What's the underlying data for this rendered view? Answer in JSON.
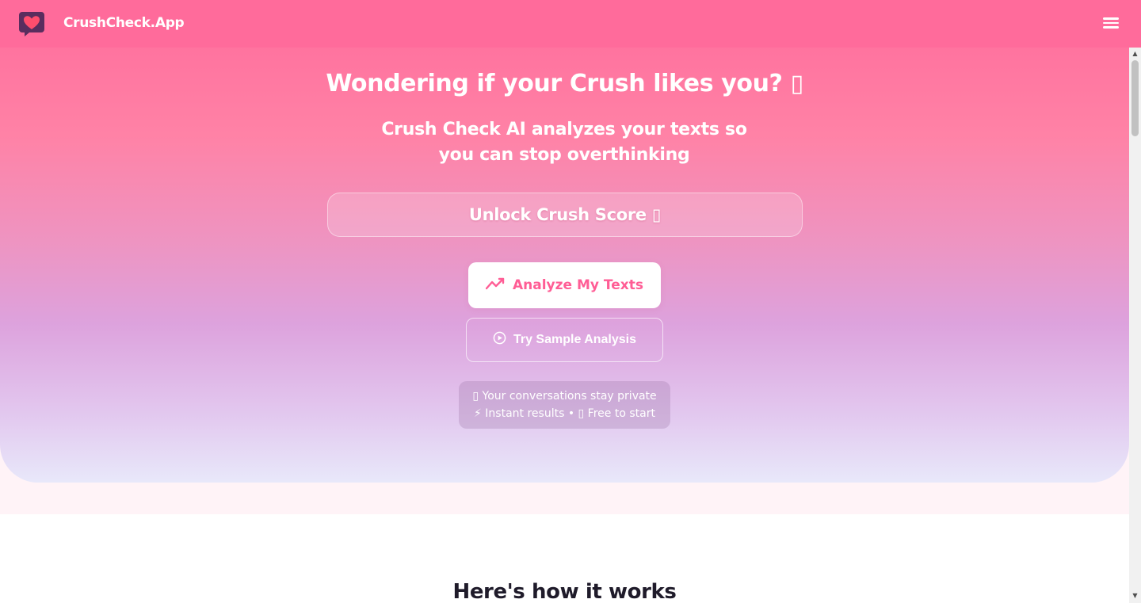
{
  "header": {
    "brand": "CrushCheck.App",
    "logo_icon": "heart-chat-bubble-icon",
    "menu_icon": "hamburger-menu-icon",
    "colors": {
      "background": "#ff6b9b",
      "logo_bubble": "#5a2d5e",
      "logo_heart": "#ff4d6d"
    }
  },
  "hero": {
    "title": "Wondering if your Crush likes you? ▯",
    "subtitle": "Crush Check AI analyzes your texts so you can stop overthinking",
    "unlock_label": "Unlock Crush Score ▯",
    "analyze_label": "Analyze My Texts",
    "analyze_icon": "trending-line-icon",
    "sample_label": "Try Sample Analysis",
    "sample_icon": "play-circle-icon",
    "privacy_line1": "▯ Your conversations stay private",
    "privacy_line2": "⚡ Instant results • ▯ Free to start",
    "colors": {
      "gradient_top": "#ff6b9b",
      "gradient_mid": "#dda2dd",
      "gradient_bottom": "#e8e8fa",
      "accent": "#ff5d95"
    }
  },
  "how_it_works": {
    "title": "Here's how it works"
  },
  "scrollbar": {
    "up_arrow": "▲",
    "down_arrow": "▼"
  }
}
